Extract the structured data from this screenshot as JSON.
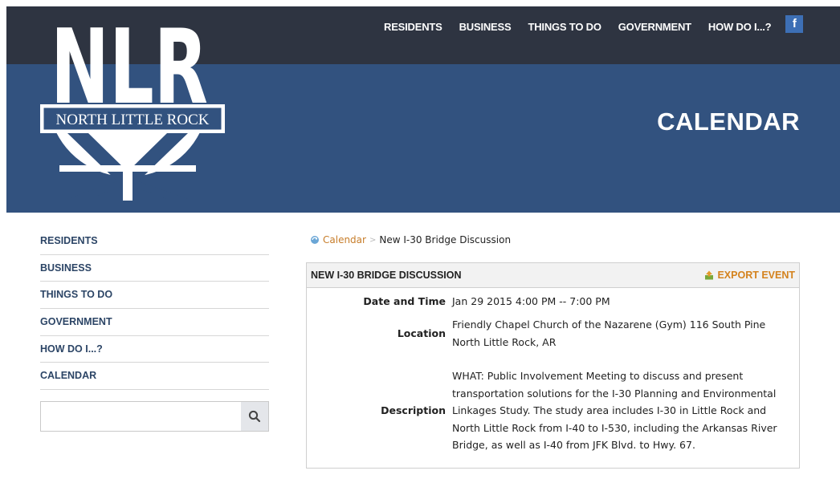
{
  "logo": {
    "letters": "NLR",
    "city_name": "NORTH LITTLE ROCK"
  },
  "top_nav": [
    "RESIDENTS",
    "BUSINESS",
    "THINGS TO DO",
    "GOVERNMENT",
    "HOW DO I...?"
  ],
  "social": {
    "facebook": "f"
  },
  "page_heading": "CALENDAR",
  "sidebar": {
    "items": [
      "RESIDENTS",
      "BUSINESS",
      "THINGS TO DO",
      "GOVERNMENT",
      "HOW DO I...?",
      "CALENDAR"
    ],
    "search_placeholder": ""
  },
  "breadcrumb": {
    "link": "Calendar",
    "separator": ">",
    "current": "New I-30 Bridge Discussion"
  },
  "event": {
    "title": "NEW I-30 BRIDGE DISCUSSION",
    "export_label": "EXPORT EVENT",
    "date_label": "Date and Time",
    "date_value": "Jan 29 2015 4:00 PM -- 7:00 PM",
    "location_label": "Location",
    "location_value": "Friendly Chapel Church of the Nazarene (Gym) 116 South Pine North Little Rock, AR",
    "description_label": "Description",
    "description_value": "WHAT: Public Involvement Meeting to discuss and present transportation solutions for the I-30 Planning and Environmental Linkages Study. The study area includes I-30 in Little Rock and North Little Rock from I-40 to I-530, including the Arkansas River Bridge, as well as I-40 from JFK Blvd. to Hwy. 67."
  },
  "colors": {
    "topbar": "#2e3441",
    "band": "#32527f",
    "nav_text": "#2c4566",
    "accent": "#d4821d"
  }
}
